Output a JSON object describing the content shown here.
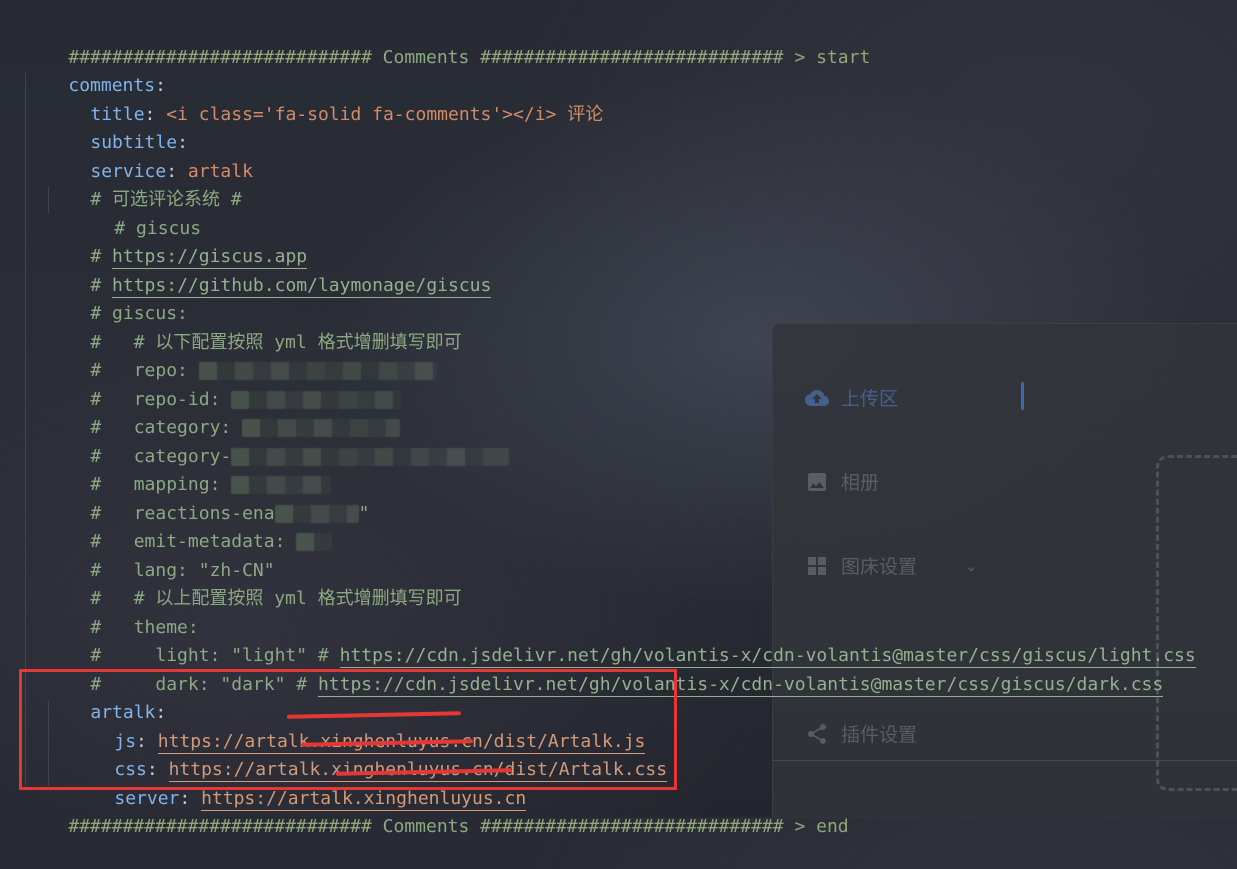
{
  "editor": {
    "lines": [
      {
        "text_before": "############################ ",
        "label": "Comments",
        "text_after": " ############################ > start"
      },
      {
        "key": "comments",
        "suffix": ":"
      },
      {
        "key": "title",
        "colon": ": ",
        "value": "<i class='fa-solid fa-comments'></i> 评论"
      },
      {
        "key": "subtitle",
        "colon": ":"
      },
      {
        "key": "service",
        "colon": ": ",
        "value": "artalk"
      },
      {
        "comment": "# 可选评论系统 #"
      },
      {
        "comment": "# giscus"
      },
      {
        "comment_prefix": "# ",
        "url": "https://giscus.app"
      },
      {
        "comment_prefix": "# ",
        "url": "https://github.com/laymonage/giscus"
      },
      {
        "comment": "# giscus:"
      },
      {
        "comment": "#   # 以下配置按照 yml 格式增删填写即可"
      },
      {
        "comment": "#   repo: "
      },
      {
        "comment": "#   repo-id: "
      },
      {
        "comment": "#   category: "
      },
      {
        "comment": "#   category-"
      },
      {
        "comment": "#   mapping: "
      },
      {
        "comment": "#   reactions-ena",
        "comment_suffix": "\""
      },
      {
        "comment": "#   emit-metadata: "
      },
      {
        "comment": "#   lang: \"zh-CN\""
      },
      {
        "comment": "#   # 以上配置按照 yml 格式增删填写即可"
      },
      {
        "comment": "#   theme:"
      },
      {
        "comment_prefix": "#     light: \"light\" # ",
        "url": "https://cdn.jsdelivr.net/gh/volantis-x/cdn-volantis@master/css/giscus/light.css"
      },
      {
        "comment_prefix": "#     dark: \"dark\" # ",
        "url": "https://cdn.jsdelivr.net/gh/volantis-x/cdn-volantis@master/css/giscus/dark.css"
      },
      {
        "key": "artalk",
        "colon": ":"
      },
      {
        "key": "js",
        "colon": ": ",
        "url": "https://artalk.xinghenluyus.cn/dist/Artalk.js"
      },
      {
        "key": "css",
        "colon": ": ",
        "url": "https://artalk.xinghenluyus.cn/dist/Artalk.css"
      },
      {
        "key": "server",
        "colon": ": ",
        "url": "https://artalk.xinghenluyus.cn"
      },
      {
        "text_before": "############################ ",
        "label": "Comments",
        "text_after": " ############################ > end"
      }
    ]
  },
  "overlay": {
    "upload_label": "上传区",
    "album_label": "相册",
    "image_host_label": "图床设置",
    "plugin_label": "插件设置",
    "icons": {
      "upload": "cloud-upload-icon",
      "album": "image-icon",
      "image_host": "grid-icon",
      "plugin": "share-icon",
      "chevron": "chevron-down-icon"
    },
    "colors": {
      "upload_accent": "#3e68b8"
    }
  },
  "annotation": {
    "color": "#e53735"
  }
}
